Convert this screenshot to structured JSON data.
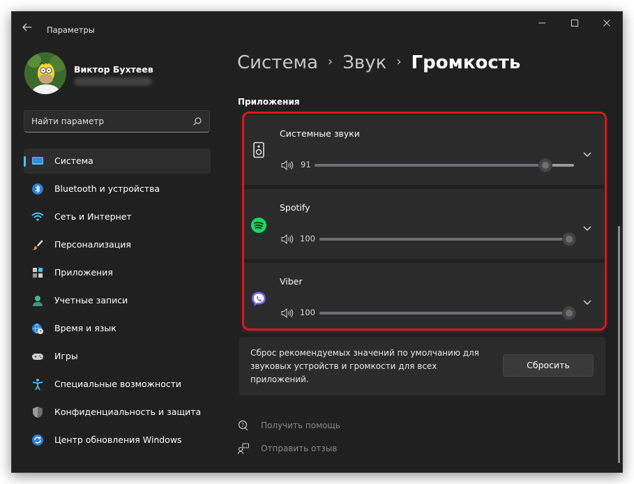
{
  "window": {
    "title": "Параметры",
    "controls": {
      "minimize": "—",
      "maximize": "☐",
      "close": "✕"
    }
  },
  "profile": {
    "name": "Виктор Бухтеев"
  },
  "search": {
    "placeholder": "Найти параметр"
  },
  "sidebar": {
    "items": [
      {
        "label": "Система",
        "icon": "monitor-icon",
        "active": true
      },
      {
        "label": "Bluetooth и устройства",
        "icon": "bluetooth-icon"
      },
      {
        "label": "Сеть и Интернет",
        "icon": "wifi-icon"
      },
      {
        "label": "Персонализация",
        "icon": "brush-icon"
      },
      {
        "label": "Приложения",
        "icon": "apps-icon"
      },
      {
        "label": "Учетные записи",
        "icon": "person-icon"
      },
      {
        "label": "Время и язык",
        "icon": "globe-clock-icon"
      },
      {
        "label": "Игры",
        "icon": "gamepad-icon"
      },
      {
        "label": "Специальные возможности",
        "icon": "accessibility-icon"
      },
      {
        "label": "Конфиденциальность и защита",
        "icon": "shield-icon"
      },
      {
        "label": "Центр обновления Windows",
        "icon": "update-icon"
      }
    ]
  },
  "breadcrumb": {
    "part1": "Система",
    "part2": "Звук",
    "current": "Громкость",
    "separator": "›"
  },
  "section": {
    "title": "Приложения"
  },
  "apps": [
    {
      "name": "Системные звуки",
      "volume": "91",
      "icon": "speaker-icon"
    },
    {
      "name": "Spotify",
      "volume": "100",
      "icon": "spotify-icon"
    },
    {
      "name": "Viber",
      "volume": "100",
      "icon": "viber-icon"
    }
  ],
  "reset": {
    "text": "Сброс рекомендуемых значений по умолчанию для звуковых устройств и громкости для всех приложений.",
    "button": "Сбросить"
  },
  "links": {
    "help": "Получить помощь",
    "feedback": "Отправить отзыв"
  },
  "colors": {
    "accent": "#4cc2ff",
    "highlight": "#e8121c",
    "spotify": "#1ed760",
    "viber": "#7360f2"
  }
}
